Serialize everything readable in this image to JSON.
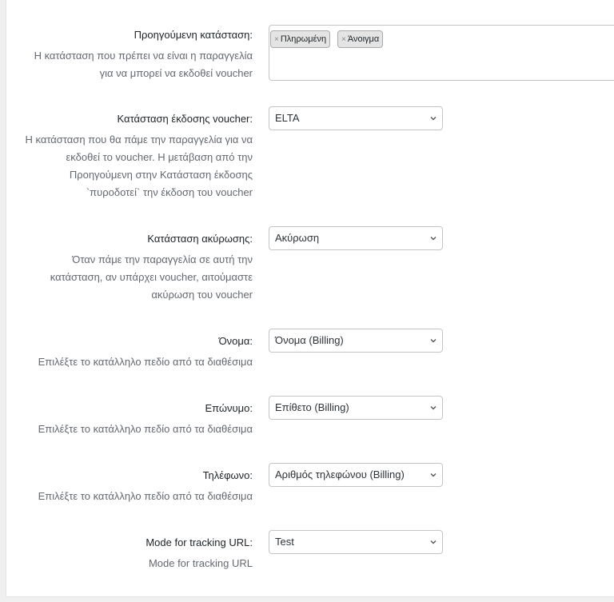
{
  "fields": [
    {
      "label": "Προηγούμενη κατάσταση:",
      "desc": [
        "Η κατάσταση που πρέπει να είναι η παραγγελία",
        "για να μπορεί να εκδοθεί voucher"
      ],
      "tags": [
        "Πληρωμένη",
        "Άνοιγμα"
      ]
    },
    {
      "label": "Κατάσταση έκδοσης voucher:",
      "desc": [
        "Η κατάσταση που θα πάμε την παραγγελία για να",
        "εκδοθεί το voucher. Η μετάβαση από την",
        "Προηγούμενη στην Κατάσταση έκδοσης",
        "`πυροδοτεί` την έκδοση του voucher"
      ],
      "value": "ELTA"
    },
    {
      "label": "Κατάσταση ακύρωσης:",
      "desc": [
        "Όταν πάμε την παραγγελία σε αυτή την",
        "κατάσταση, αν υπάρχει voucher, αιτούμαστε",
        "ακύρωση του voucher"
      ],
      "value": "Ακύρωση"
    },
    {
      "label": "Όνομα:",
      "desc": [
        "Επιλέξτε το κατάλληλο πεδίο από τα διαθέσιμα"
      ],
      "value": "Όνομα (Billing)"
    },
    {
      "label": "Επώνυμο:",
      "desc": [
        "Επιλέξτε το κατάλληλο πεδίο από τα διαθέσιμα"
      ],
      "value": "Επίθετο (Billing)"
    },
    {
      "label": "Τηλέφωνο:",
      "desc": [
        "Επιλέξτε το κατάλληλο πεδίο από τα διαθέσιμα"
      ],
      "value": "Αριθμός τηλεφώνου (Billing)"
    },
    {
      "label": "Mode for tracking URL:",
      "desc": [
        "Mode for tracking URL"
      ],
      "value": "Test"
    }
  ],
  "icons": {
    "tag_remove": "×",
    "chevron": "chevron-down-icon"
  }
}
